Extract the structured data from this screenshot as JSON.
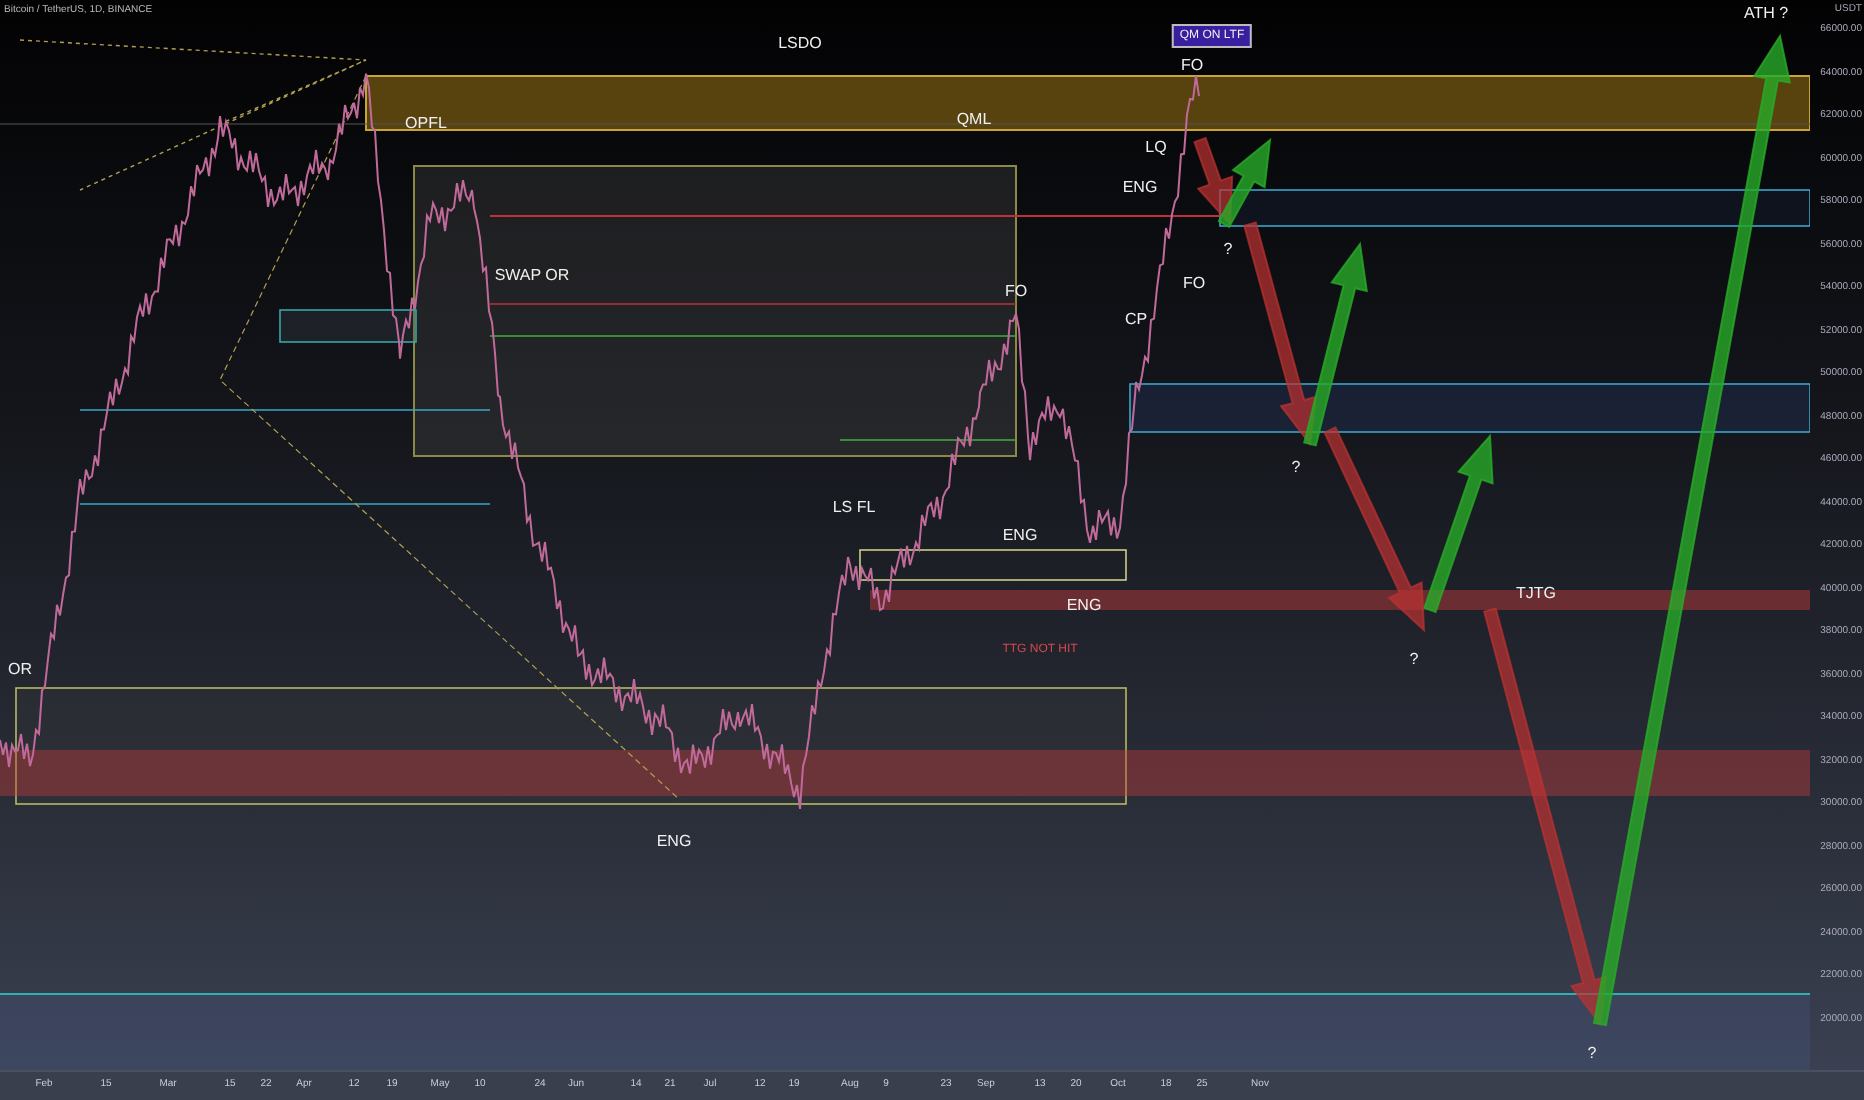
{
  "header": {
    "symbol": "Bitcoin / TetherUS, 1D, BINANCE"
  },
  "annotations": [
    {
      "text": "ATH ?",
      "kind": "label"
    },
    {
      "text": "LSDO",
      "kind": "label"
    },
    {
      "text": "QM ON LTF",
      "kind": "badge"
    },
    {
      "text": "FO",
      "kind": "label"
    },
    {
      "text": "QML",
      "kind": "label"
    },
    {
      "text": "OPFL",
      "kind": "label"
    },
    {
      "text": "LQ",
      "kind": "label"
    },
    {
      "text": "ENG",
      "kind": "label"
    },
    {
      "text": "?",
      "kind": "label"
    },
    {
      "text": "SWAP OR",
      "kind": "label"
    },
    {
      "text": "FO",
      "kind": "label"
    },
    {
      "text": "FO",
      "kind": "label"
    },
    {
      "text": "CP",
      "kind": "label"
    },
    {
      "text": "?",
      "kind": "label"
    },
    {
      "text": "LS FL",
      "kind": "label"
    },
    {
      "text": "ENG",
      "kind": "label"
    },
    {
      "text": "TJTG",
      "kind": "label"
    },
    {
      "text": "ENG",
      "kind": "label"
    },
    {
      "text": "TTG NOT HIT",
      "kind": "warning"
    },
    {
      "text": "OR",
      "kind": "label"
    },
    {
      "text": "?",
      "kind": "label"
    },
    {
      "text": "ENG",
      "kind": "label"
    },
    {
      "text": "?",
      "kind": "label"
    }
  ],
  "price_axis": {
    "currency": "USDT",
    "labels": [
      "66000.00",
      "64000.00",
      "62000.00",
      "60000.00",
      "58000.00",
      "56000.00",
      "54000.00",
      "52000.00",
      "50000.00",
      "48000.00",
      "46000.00",
      "44000.00",
      "42000.00",
      "40000.00",
      "38000.00",
      "36000.00",
      "34000.00",
      "32000.00",
      "30000.00",
      "28000.00",
      "26000.00",
      "24000.00",
      "22000.00",
      "20000.00"
    ]
  },
  "time_axis": {
    "labels": [
      "Feb",
      "15",
      "Mar",
      "15",
      "22",
      "Apr",
      "12",
      "19",
      "May",
      "10",
      "24",
      "Jun",
      "14",
      "21",
      "Jul",
      "12",
      "19",
      "Aug",
      "9",
      "23",
      "Sep",
      "13",
      "20",
      "Oct",
      "18",
      "25",
      "Nov"
    ]
  }
}
